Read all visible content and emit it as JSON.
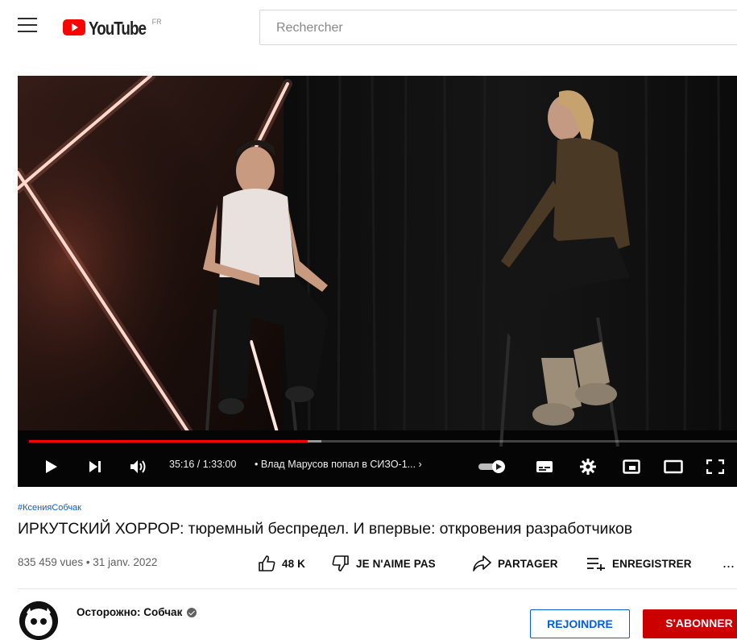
{
  "header": {
    "logo_text": "YouTube",
    "country_code": "FR",
    "search_placeholder": "Rechercher"
  },
  "player": {
    "current_time": "35:16 / 1:33:00",
    "chapter_title": "• Влад Марусов попал в СИЗО-1... ›",
    "progress_played_fraction": 0.39,
    "progress_loaded_fraction": 0.41,
    "brand_red": "#ff0000"
  },
  "video": {
    "hashtag": "#КсенияСобчак",
    "title": "ИРКУТСКИЙ ХОРРОР: тюремный беспредел. И впервые: откровения разработчиков",
    "views_date": "835 459 vues • 31 janv. 2022",
    "actions": {
      "like_count": "48 K",
      "dislike_label": "JE N'AIME PAS",
      "share_label": "PARTAGER",
      "save_label": "ENREGISTRER",
      "more_label": "..."
    }
  },
  "channel": {
    "name": "Осторожно: Собчак",
    "join_label": "REJOINDRE",
    "subscribe_label": "S'ABONNER",
    "accent_blue": "#065fd4",
    "subscribe_red": "#cc0000"
  },
  "icons": [
    "menu-icon",
    "youtube-logo-icon",
    "play-icon",
    "next-icon",
    "volume-icon",
    "autoplay-toggle-icon",
    "subtitles-icon",
    "settings-gear-icon",
    "miniplayer-icon",
    "theater-icon",
    "fullscreen-icon",
    "like-icon",
    "dislike-icon",
    "share-icon",
    "save-playlist-icon",
    "verified-icon"
  ]
}
